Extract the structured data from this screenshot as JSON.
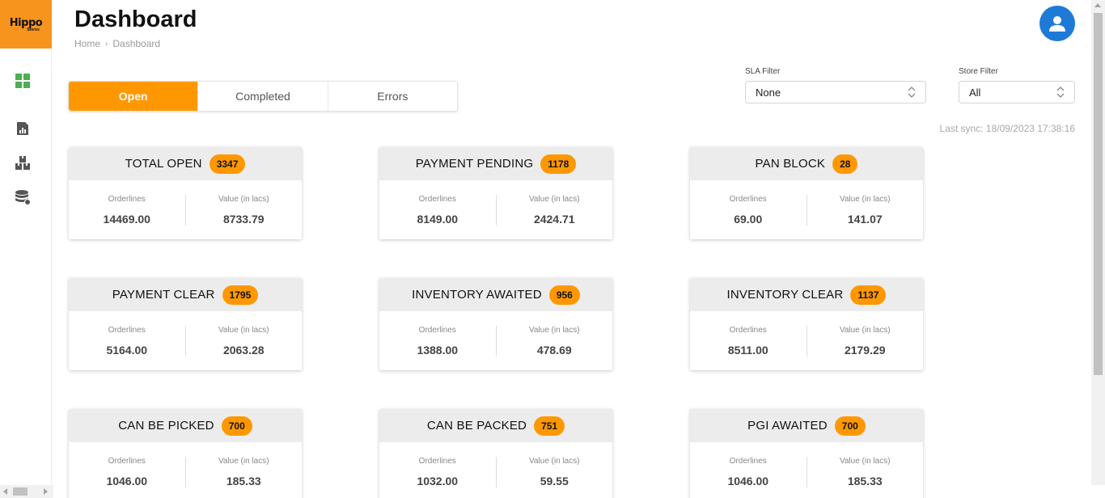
{
  "app": {
    "logo_text": "Hippo",
    "logo_sub": "Stores"
  },
  "sidebar": {
    "items": [
      {
        "icon": "dashboard-grid-icon",
        "active": true
      },
      {
        "icon": "report-chart-icon"
      },
      {
        "icon": "boxes-inventory-icon"
      },
      {
        "icon": "database-icon"
      }
    ]
  },
  "header": {
    "title": "Dashboard",
    "breadcrumb": [
      "Home",
      "Dashboard"
    ],
    "avatar_icon": "user-icon"
  },
  "tabs": [
    {
      "label": "Open",
      "active": true
    },
    {
      "label": "Completed"
    },
    {
      "label": "Errors"
    }
  ],
  "filters": {
    "sla": {
      "label": "SLA Filter",
      "value": "None"
    },
    "store": {
      "label": "Store Filter",
      "value": "All"
    }
  },
  "last_sync": "Last sync: 18/09/2023 17:38:16",
  "cards": [
    {
      "title": "TOTAL OPEN",
      "count": "3347",
      "orderlines_label": "Orderlines",
      "orderlines": "14469.00",
      "value_label": "Value (in lacs)",
      "value": "8733.79"
    },
    {
      "title": "PAYMENT PENDING",
      "count": "1178",
      "orderlines_label": "Orderlines",
      "orderlines": "8149.00",
      "value_label": "Value (in lacs)",
      "value": "2424.71"
    },
    {
      "title": "PAN BLOCK",
      "count": "28",
      "orderlines_label": "Orderlines",
      "orderlines": "69.00",
      "value_label": "Value (in lacs)",
      "value": "141.07"
    },
    {
      "title": "PAYMENT CLEAR",
      "count": "1795",
      "orderlines_label": "Orderlines",
      "orderlines": "5164.00",
      "value_label": "Value (in lacs)",
      "value": "2063.28"
    },
    {
      "title": "INVENTORY AWAITED",
      "count": "956",
      "orderlines_label": "Orderlines",
      "orderlines": "1388.00",
      "value_label": "Value (in lacs)",
      "value": "478.69"
    },
    {
      "title": "INVENTORY CLEAR",
      "count": "1137",
      "orderlines_label": "Orderlines",
      "orderlines": "8511.00",
      "value_label": "Value (in lacs)",
      "value": "2179.29"
    },
    {
      "title": "CAN BE PICKED",
      "count": "700",
      "orderlines_label": "Orderlines",
      "orderlines": "1046.00",
      "value_label": "Value (in lacs)",
      "value": "185.33"
    },
    {
      "title": "CAN BE PACKED",
      "count": "751",
      "orderlines_label": "Orderlines",
      "orderlines": "1032.00",
      "value_label": "Value (in lacs)",
      "value": "59.55"
    },
    {
      "title": "PGI AWAITED",
      "count": "700",
      "orderlines_label": "Orderlines",
      "orderlines": "1046.00",
      "value_label": "Value (in lacs)",
      "value": "185.33"
    }
  ],
  "colors": {
    "accent": "#ff9800",
    "logo_bg": "#f7941d",
    "avatar": "#1e7ad6",
    "nav_active": "#4caf50"
  }
}
